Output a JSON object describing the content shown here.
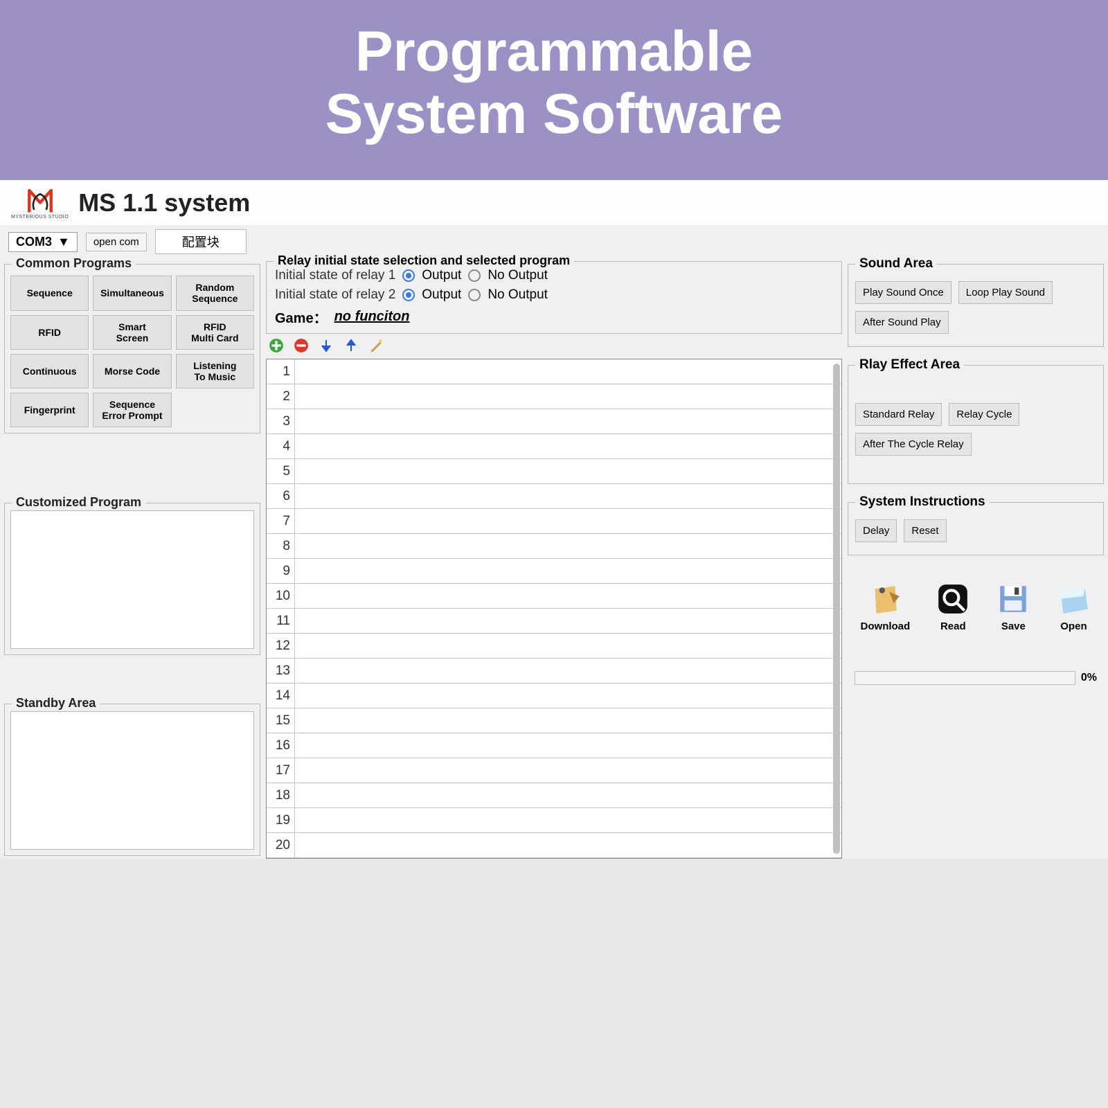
{
  "banner": {
    "line1": "Programmable",
    "line2": "System Software"
  },
  "logo_subtext": "MYSTERIOUS STUDIO",
  "app_title": "MS 1.1 system",
  "top": {
    "com_port": "COM3",
    "open_com": "open com",
    "config": "配置块"
  },
  "common_programs": {
    "legend": "Common Programs",
    "buttons": [
      "Sequence",
      "Simultaneous",
      "Random\nSequence",
      "RFID",
      "Smart\nScreen",
      "RFID\nMulti Card",
      "Continuous",
      "Morse Code",
      "Listening\nTo Music",
      "Fingerprint",
      "Sequence\nError Prompt",
      ""
    ]
  },
  "customized": {
    "legend": "Customized Program"
  },
  "standby": {
    "legend": "Standby Area"
  },
  "relay": {
    "legend": "Relay initial state selection and selected program",
    "r1_label": "Initial state of relay 1",
    "r2_label": "Initial state of relay 2",
    "opt_output": "Output",
    "opt_no_output": "No Output",
    "r1_selected": "output",
    "r2_selected": "output",
    "game_label": "Game：",
    "game_value": "no funciton"
  },
  "list": {
    "rows": 20
  },
  "sound_area": {
    "legend": "Sound Area",
    "buttons": [
      "Play Sound Once",
      "Loop Play Sound",
      "After Sound Play"
    ]
  },
  "relay_effect": {
    "legend": "Rlay Effect Area",
    "buttons": [
      "Standard Relay",
      "Relay Cycle",
      "After The Cycle Relay"
    ]
  },
  "system_instructions": {
    "legend": "System Instructions",
    "buttons": [
      "Delay",
      "Reset"
    ]
  },
  "file_actions": {
    "download": "Download",
    "read": "Read",
    "save": "Save",
    "open": "Open"
  },
  "progress": {
    "value": "0%"
  }
}
